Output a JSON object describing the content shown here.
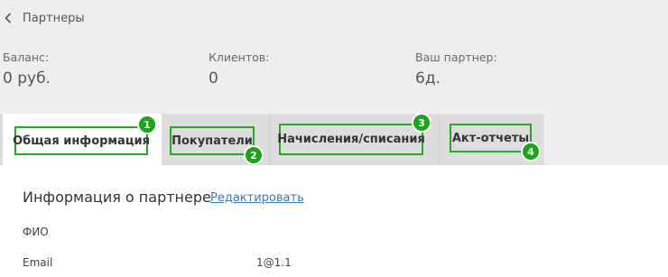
{
  "header": {
    "back_label": "Партнеры"
  },
  "stats": [
    {
      "label": "Баланс:",
      "value": "0 руб."
    },
    {
      "label": "Клиентов:",
      "value": "0"
    },
    {
      "label": "Ваш партнер:",
      "value": "6д."
    }
  ],
  "tabs": [
    {
      "label": "Общая информация",
      "badge": "1"
    },
    {
      "label": "Покупатели",
      "badge": "2"
    },
    {
      "label": "Начисления/списания",
      "badge": "3"
    },
    {
      "label": "Акт-отчеты",
      "badge": "4"
    }
  ],
  "section": {
    "title": "Информация о партнере",
    "edit_label": "Редактировать"
  },
  "fields": [
    {
      "label": "ФИО",
      "value": ""
    },
    {
      "label": "Email",
      "value": "1@1.1"
    }
  ],
  "colors": {
    "highlight": "#22aa22",
    "badge": "#1aa51a",
    "link": "#3a76c4"
  }
}
